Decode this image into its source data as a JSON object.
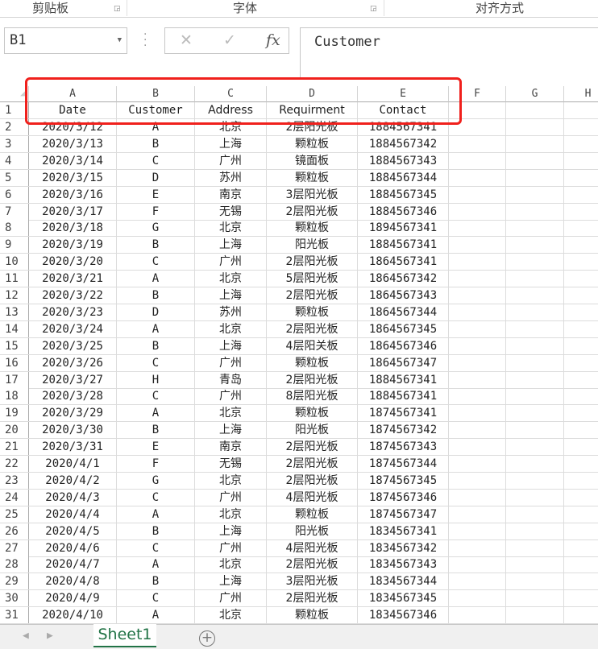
{
  "ribbon": {
    "groups": [
      "剪贴板",
      "字体",
      "对齐方式"
    ]
  },
  "name_box": {
    "value": "B1"
  },
  "formula_bar": {
    "cancel_icon": "✕",
    "enter_icon": "✓",
    "fx_label": "fx",
    "value": "Customer"
  },
  "columns": [
    "A",
    "B",
    "C",
    "D",
    "E",
    "F",
    "G",
    "H"
  ],
  "table": {
    "headers": [
      "Date",
      "Customer",
      "Address",
      "Requirment",
      "Contact"
    ],
    "rows": [
      [
        "2020/3/12",
        "A",
        "北京",
        "2层阳光板",
        "1884567341"
      ],
      [
        "2020/3/13",
        "B",
        "上海",
        "颗粒板",
        "1884567342"
      ],
      [
        "2020/3/14",
        "C",
        "广州",
        "镜面板",
        "1884567343"
      ],
      [
        "2020/3/15",
        "D",
        "苏州",
        "颗粒板",
        "1884567344"
      ],
      [
        "2020/3/16",
        "E",
        "南京",
        "3层阳光板",
        "1884567345"
      ],
      [
        "2020/3/17",
        "F",
        "无锡",
        "2层阳光板",
        "1884567346"
      ],
      [
        "2020/3/18",
        "G",
        "北京",
        "颗粒板",
        "1894567341"
      ],
      [
        "2020/3/19",
        "B",
        "上海",
        "阳光板",
        "1884567341"
      ],
      [
        "2020/3/20",
        "C",
        "广州",
        "2层阳光板",
        "1864567341"
      ],
      [
        "2020/3/21",
        "A",
        "北京",
        "5层阳光板",
        "1864567342"
      ],
      [
        "2020/3/22",
        "B",
        "上海",
        "2层阳光板",
        "1864567343"
      ],
      [
        "2020/3/23",
        "D",
        "苏州",
        "颗粒板",
        "1864567344"
      ],
      [
        "2020/3/24",
        "A",
        "北京",
        "2层阳光板",
        "1864567345"
      ],
      [
        "2020/3/25",
        "B",
        "上海",
        "4层阳关板",
        "1864567346"
      ],
      [
        "2020/3/26",
        "C",
        "广州",
        "颗粒板",
        "1864567347"
      ],
      [
        "2020/3/27",
        "H",
        "青岛",
        "2层阳光板",
        "1884567341"
      ],
      [
        "2020/3/28",
        "C",
        "广州",
        "8层阳光板",
        "1884567341"
      ],
      [
        "2020/3/29",
        "A",
        "北京",
        "颗粒板",
        "1874567341"
      ],
      [
        "2020/3/30",
        "B",
        "上海",
        "阳光板",
        "1874567342"
      ],
      [
        "2020/3/31",
        "E",
        "南京",
        "2层阳光板",
        "1874567343"
      ],
      [
        "2020/4/1",
        "F",
        "无锡",
        "2层阳光板",
        "1874567344"
      ],
      [
        "2020/4/2",
        "G",
        "北京",
        "2层阳光板",
        "1874567345"
      ],
      [
        "2020/4/3",
        "C",
        "广州",
        "4层阳光板",
        "1874567346"
      ],
      [
        "2020/4/4",
        "A",
        "北京",
        "颗粒板",
        "1874567347"
      ],
      [
        "2020/4/5",
        "B",
        "上海",
        "阳光板",
        "1834567341"
      ],
      [
        "2020/4/6",
        "C",
        "广州",
        "4层阳光板",
        "1834567342"
      ],
      [
        "2020/4/7",
        "A",
        "北京",
        "2层阳光板",
        "1834567343"
      ],
      [
        "2020/4/8",
        "B",
        "上海",
        "3层阳光板",
        "1834567344"
      ],
      [
        "2020/4/9",
        "C",
        "广州",
        "2层阳光板",
        "1834567345"
      ],
      [
        "2020/4/10",
        "A",
        "北京",
        "颗粒板",
        "1834567346"
      ]
    ]
  },
  "sheet_tabs": {
    "active": "Sheet1",
    "add_icon": "+"
  },
  "colors": {
    "highlight": "#f0201c",
    "tab_accent": "#217346"
  }
}
